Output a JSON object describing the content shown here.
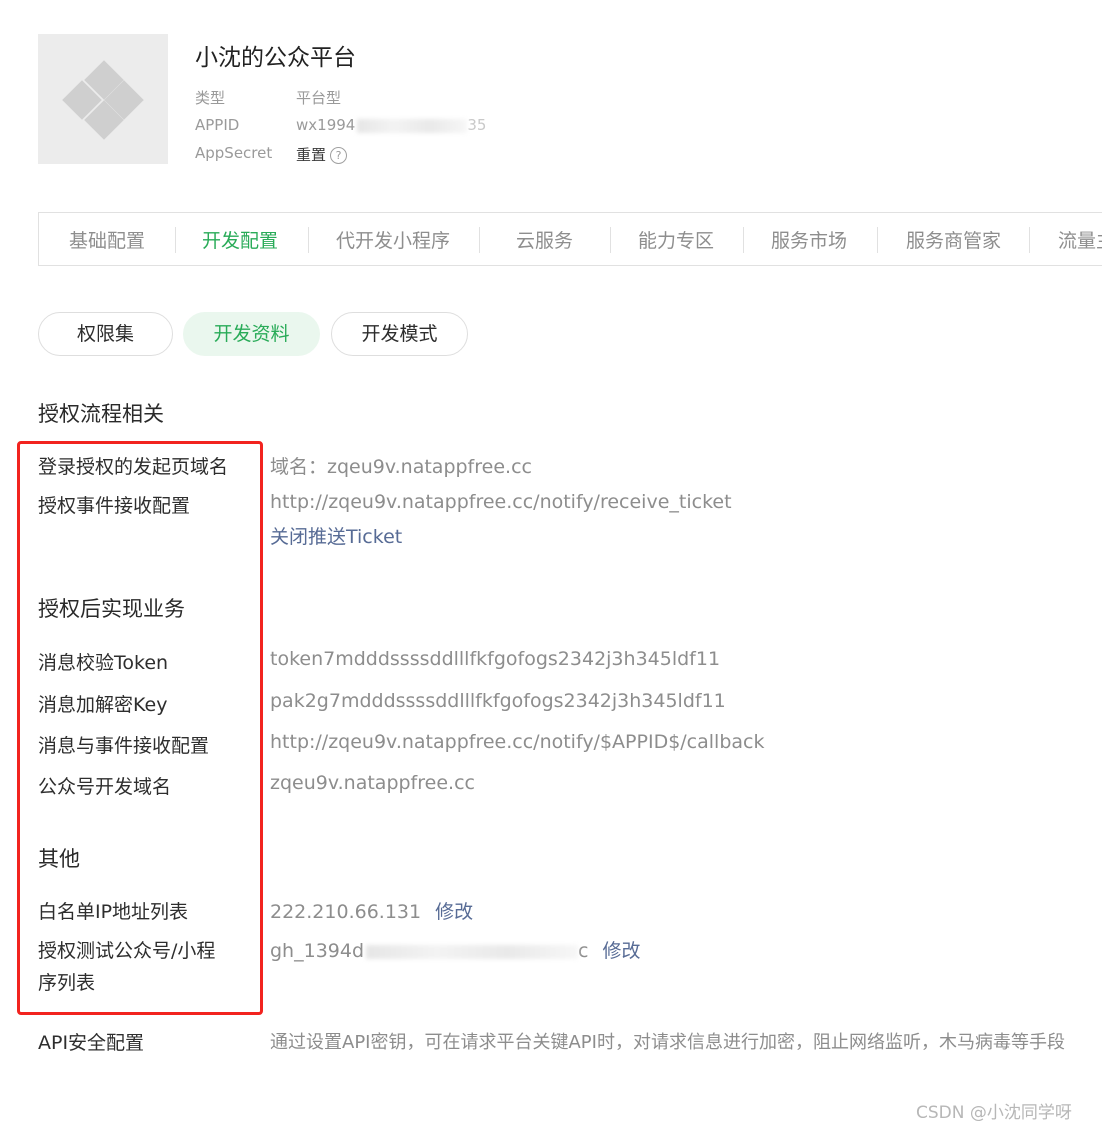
{
  "account": {
    "name": "小沈的公众平台",
    "type_label": "类型",
    "type_value": "平台型",
    "appid_label": "APPID",
    "appid_value": "wx1994",
    "appid_tail": "35",
    "secret_label": "AppSecret",
    "secret_action": "重置",
    "help_glyph": "?"
  },
  "tabs": [
    "基础配置",
    "开发配置",
    "代开发小程序",
    "云服务",
    "能力专区",
    "服务市场",
    "服务商管家",
    "流量主"
  ],
  "active_tab": "开发配置",
  "subtabs": [
    "权限集",
    "开发资料",
    "开发模式"
  ],
  "active_subtab": "开发资料",
  "sections": {
    "auth_flow": {
      "title": "授权流程相关",
      "login_domain_label": "登录授权的发起页域名",
      "login_domain_value": "域名：zqeu9v.natappfree.cc",
      "event_label": "授权事件接收配置",
      "event_value": "http://zqeu9v.natappfree.cc/notify/receive_ticket",
      "close_ticket_link": "关闭推送Ticket"
    },
    "business": {
      "title": "授权后实现业务",
      "token_label": "消息校验Token",
      "token_value": "token7mdddssssddlllfkfgofogs2342j3h345ldf11",
      "key_label": "消息加解密Key",
      "key_value": "pak2g7mdddssssddlllfkfgofogs2342j3h345ldf11",
      "msg_label": "消息与事件接收配置",
      "msg_value": "http://zqeu9v.natappfree.cc/notify/$APPID$/callback",
      "mp_domain_label": "公众号开发域名",
      "mp_domain_value": "zqeu9v.natappfree.cc"
    },
    "other": {
      "title": "其他",
      "whitelist_label": "白名单IP地址列表",
      "whitelist_value": "222.210.66.131",
      "whitelist_edit": "修改",
      "test_label_1": "授权测试公众号/小程",
      "test_label_2": "序列表",
      "test_value_head": "gh_1394d",
      "test_value_tail": "c",
      "test_edit": "修改"
    },
    "api_security": {
      "label": "API安全配置",
      "desc": "通过设置API密钥，可在请求平台关键API时，对请求信息进行加密，阻止网络监听，木马病毒等手段"
    }
  },
  "watermark": "CSDN @小沈同学呀",
  "colors": {
    "accent": "#29ab58",
    "link": "#576b95",
    "highlight_frame": "#f2231f"
  }
}
